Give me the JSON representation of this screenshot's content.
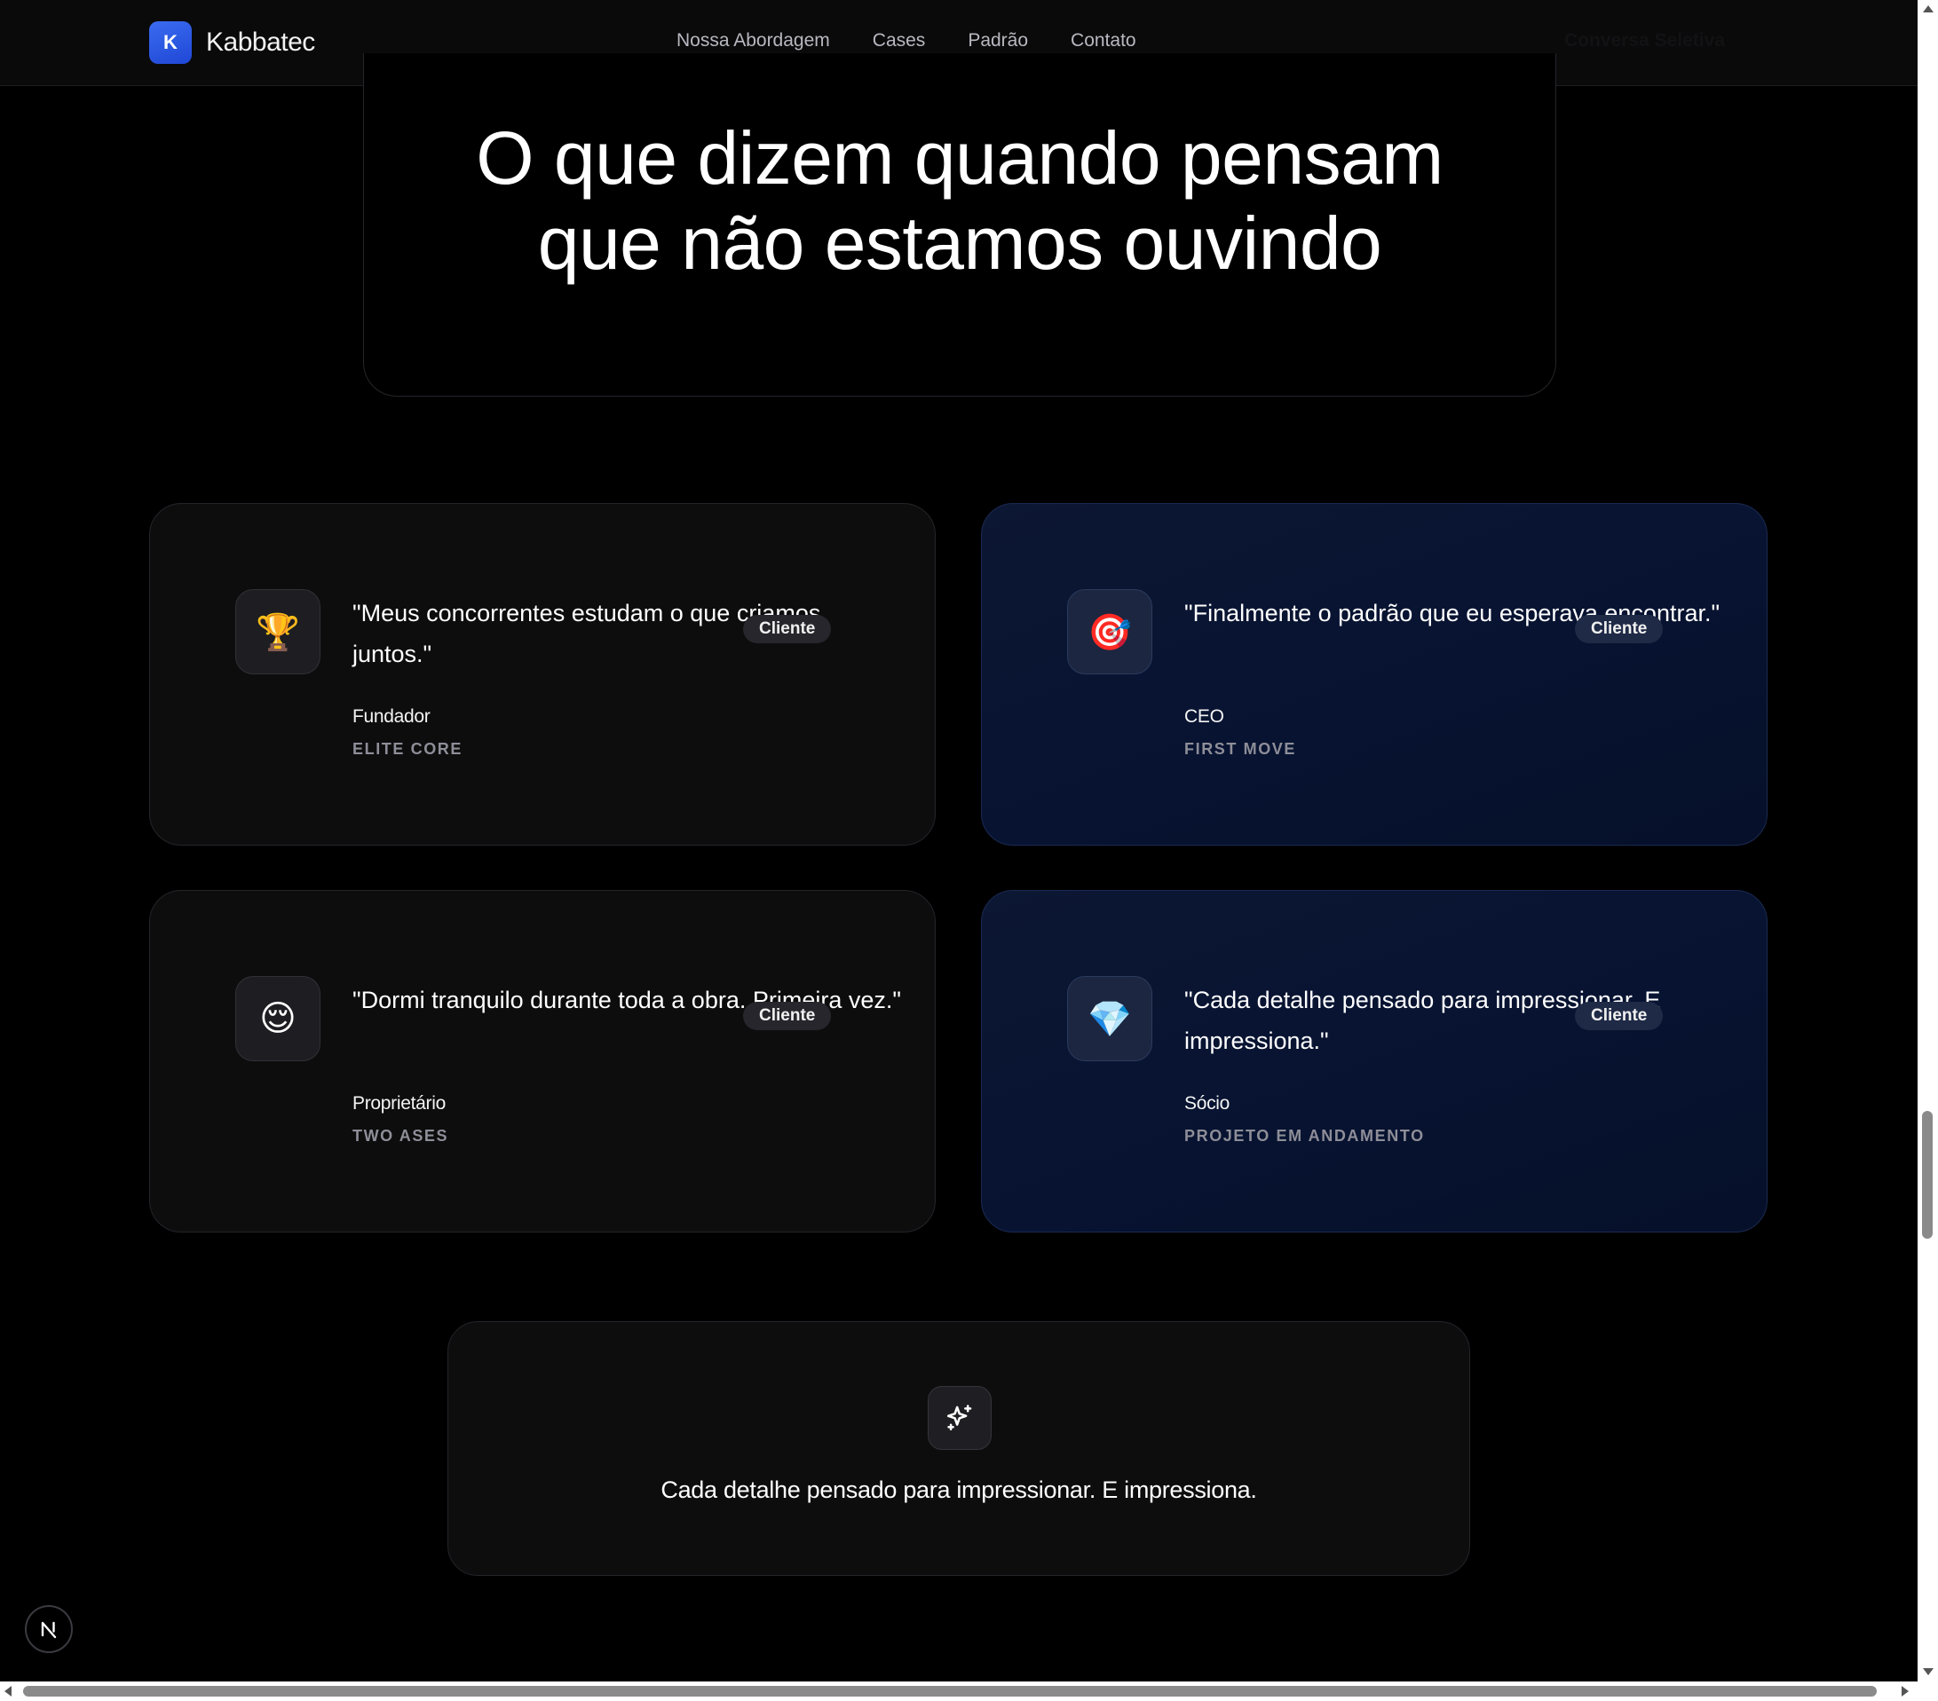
{
  "header": {
    "logo_letter": "K",
    "brand": "Kabbatec",
    "nav": [
      "Nossa Abordagem",
      "Cases",
      "Padrão",
      "Contato"
    ],
    "cta": "Conversa Seletiva"
  },
  "hero": {
    "title_line1": "O que dizem quando pensam",
    "title_line2": "que não estamos ouvindo"
  },
  "testimonials": [
    {
      "icon": "trophy-icon",
      "emoji": "🏆",
      "quote": "\"Meus concorrentes estudam o que criamos juntos.\"",
      "badge": "Cliente",
      "role": "Fundador",
      "company": "ELITE CORE"
    },
    {
      "icon": "target-icon",
      "emoji": "🎯",
      "quote": "\"Finalmente o padrão que eu esperava encontrar.\"",
      "badge": "Cliente",
      "role": "CEO",
      "company": "FIRST MOVE"
    },
    {
      "icon": "relieved-face-icon",
      "emoji": "😌",
      "quote": "\"Dormi tranquilo durante toda a obra. Primeira vez.\"",
      "badge": "Cliente",
      "role": "Proprietário",
      "company": "TWO ASES"
    },
    {
      "icon": "gem-icon",
      "emoji": "💎",
      "quote": "\"Cada detalhe pensado para impressionar. E impressiona.\"",
      "badge": "Cliente",
      "role": "Sócio",
      "company": "PROJETO EM ANDAMENTO"
    }
  ],
  "highlight": {
    "icon": "sparkles-icon",
    "text": "Cada detalhe pensado para impressionar. E impressiona."
  },
  "floating_button": {
    "letter": "N",
    "icon": "nextjs-icon"
  },
  "colors": {
    "accent": "#2a5ae6",
    "card_blue": "#071331",
    "card_dark": "#0d0d0e",
    "background": "#000000"
  }
}
